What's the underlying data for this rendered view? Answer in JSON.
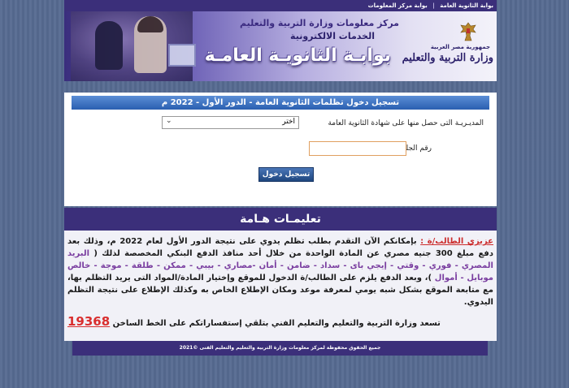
{
  "topnav": {
    "links": [
      "بوابة الثانوية العامة",
      "بوابة مركز المعلومات"
    ],
    "separator": "|"
  },
  "banner": {
    "center_line1": "مركز معلومات وزارة التربية والتعليم",
    "center_line2": "الخدمات الالكترونية",
    "portal_title": "بوابـة الثانويـة العامـة",
    "ministry_small": "جمهورية مصر العربية",
    "ministry_big": "وزارة التربية والتعليم"
  },
  "login": {
    "header": "تسجيل دخول تظلمات الثانوية العامة - الدور الأول - 2022 م",
    "directorate_label": "المديـريـة التى حصل منها على شهادة الثانوية العامة",
    "directorate_selected": "اختر",
    "seat_label": "رقم الجلوس",
    "seat_value": "",
    "submit_label": "تسجيل دخول"
  },
  "notice": {
    "heading": "تعليمـات هـامة",
    "dear": "عزيزي الطالب/ة :",
    "part1": " بإمكانكم الآن التقدم بطلب تظلم يدوي على نتيجة الدور الأول لعام 2022 م، وذلك بعد دفع مبلغ 300 جنيه مصري عن المادة الواحدة من خلال أحد منافذ الدفع البنكي المخصصة لذلك ( ",
    "payment_methods": "البريد المصري - فوري - وقتي - إيجي باى - سداد - ضامن - أمان -مصاري - بيبي - ممكن - طلقة - موجة - خالص موبايل - أموال",
    "part2": " )، وبعد الدفع يلزم على الطالب/ة الدخول للموقع وإختيار المادة/المواد التى يريد التظلم بها، مع متابعة الموقع بشكل شبه يومي لمعرفة موعد ومكان الإطلاع الخاص به وكذلك الإطلاع على نتيجة التظلم اليدوي.",
    "hotline_text": "تسعد وزارة التربية والتعليم والتعليم الفني بتلقي إستفساراتكم على الخط الساخن",
    "hotline_number": "19368"
  },
  "footer": {
    "text": "جميع الحقوق محفوظة لمركز معلومات وزارة التربية والتعليم والتعليم الفنى  ©2021"
  },
  "colors": {
    "page_bg": "#566a91",
    "nav_purple": "#3b2f7a",
    "header_blue": "#2a5fb0",
    "highlight_red": "#cc2e2e",
    "payment_purple": "#7a3ea0"
  }
}
